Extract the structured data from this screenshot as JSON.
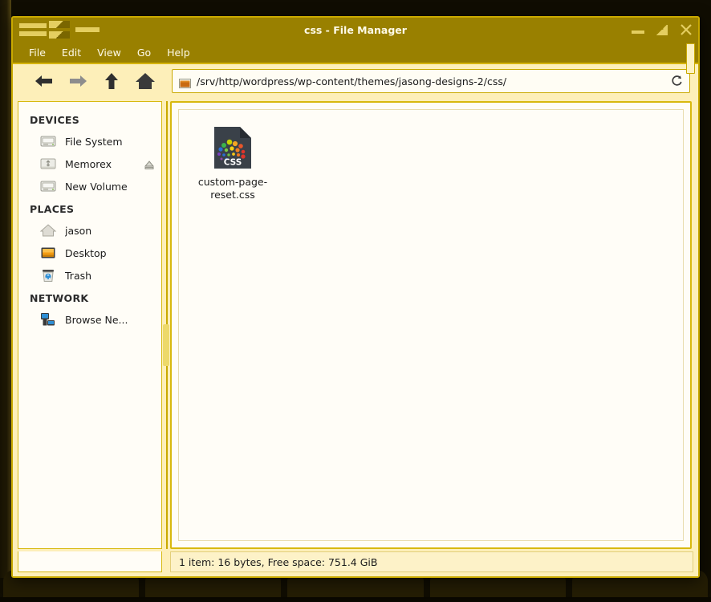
{
  "window": {
    "title": "css - File Manager",
    "menu_icon_name": "window-menu-icon",
    "controls": {
      "minimize": "Minimize",
      "maximize": "Maximize",
      "close": "Close"
    }
  },
  "menubar": {
    "items": [
      {
        "label": "File"
      },
      {
        "label": "Edit"
      },
      {
        "label": "View"
      },
      {
        "label": "Go"
      },
      {
        "label": "Help"
      }
    ]
  },
  "toolbar": {
    "back": "Back",
    "forward": "Forward",
    "up": "Open parent folder",
    "home": "Home",
    "reload": "Reload"
  },
  "pathbar": {
    "value": "/srv/http/wordpress/wp-content/themes/jasong-designs-2/css/",
    "placeholder": "Location"
  },
  "sidebar": {
    "groups": [
      {
        "title": "DEVICES",
        "items": [
          {
            "label": "File System",
            "icon": "drive-icon",
            "eject": false
          },
          {
            "label": "Memorex",
            "icon": "usb-drive-icon",
            "eject": true
          },
          {
            "label": "New Volume",
            "icon": "drive-icon",
            "eject": false
          }
        ]
      },
      {
        "title": "PLACES",
        "items": [
          {
            "label": "jason",
            "icon": "home-icon",
            "eject": false
          },
          {
            "label": "Desktop",
            "icon": "desktop-icon",
            "eject": false
          },
          {
            "label": "Trash",
            "icon": "trash-icon",
            "eject": false
          }
        ]
      },
      {
        "title": "NETWORK",
        "items": [
          {
            "label": "Browse Ne...",
            "icon": "network-icon",
            "eject": false
          }
        ]
      }
    ]
  },
  "files": [
    {
      "name": "custom-page-reset.css",
      "type": "css",
      "badge": "CSS"
    }
  ],
  "statusbar": {
    "text": "1 item: 16 bytes, Free space: 751.4 GiB"
  },
  "colors": {
    "titlebar": "#998000",
    "titlebar_text": "#fffbe8",
    "toolbar_bg": "#fdefb9",
    "pane_bg": "#fffdf7",
    "border_gold": "#d8b90f",
    "accent_gold": "#c9a900",
    "desktop_bg": "#100d02",
    "css_icon_bg": "#3a4149"
  }
}
